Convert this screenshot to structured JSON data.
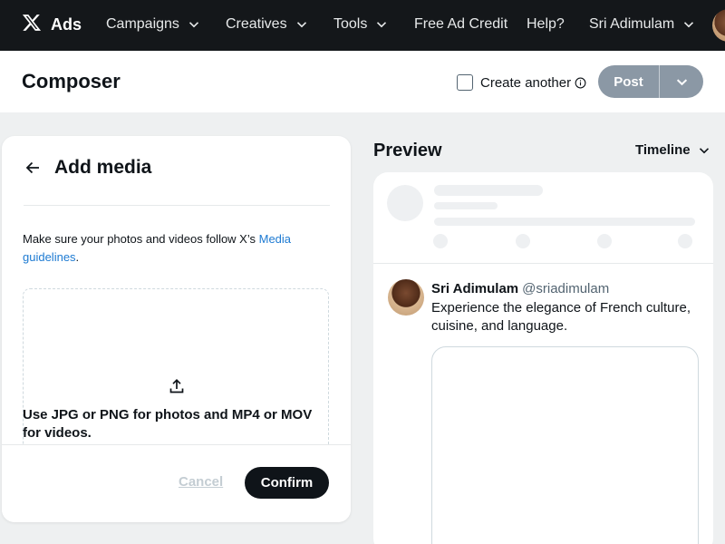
{
  "nav": {
    "brand": "Ads",
    "items": [
      {
        "label": "Campaigns",
        "has_menu": true
      },
      {
        "label": "Creatives",
        "has_menu": true
      },
      {
        "label": "Tools",
        "has_menu": true
      },
      {
        "label": "Free Ad Credit",
        "has_menu": false
      },
      {
        "label": "Help?",
        "has_menu": false
      },
      {
        "label": "Sri Adimulam",
        "has_menu": true
      }
    ]
  },
  "composer": {
    "title": "Composer",
    "create_another_label": "Create another",
    "create_another_checked": false,
    "post_label": "Post"
  },
  "add_media": {
    "title": "Add media",
    "guideline_prefix": "Make sure your photos and videos follow X’s ",
    "guideline_link": "Media guidelines",
    "guideline_suffix": ".",
    "dropzone_text": "Use JPG or PNG for photos and MP4 or MOV for videos.",
    "cancel_label": "Cancel",
    "confirm_label": "Confirm"
  },
  "preview": {
    "title": "Preview",
    "placement": "Timeline",
    "tweet": {
      "name": "Sri Adimulam",
      "handle": "@sriadimulam",
      "text": "Experience the elegance of French culture, cuisine, and language."
    }
  },
  "colors": {
    "nav_bg": "#14171a",
    "link": "#1d7ad2",
    "post_disabled": "#8b98a5",
    "confirm_bg": "#0f1419"
  }
}
